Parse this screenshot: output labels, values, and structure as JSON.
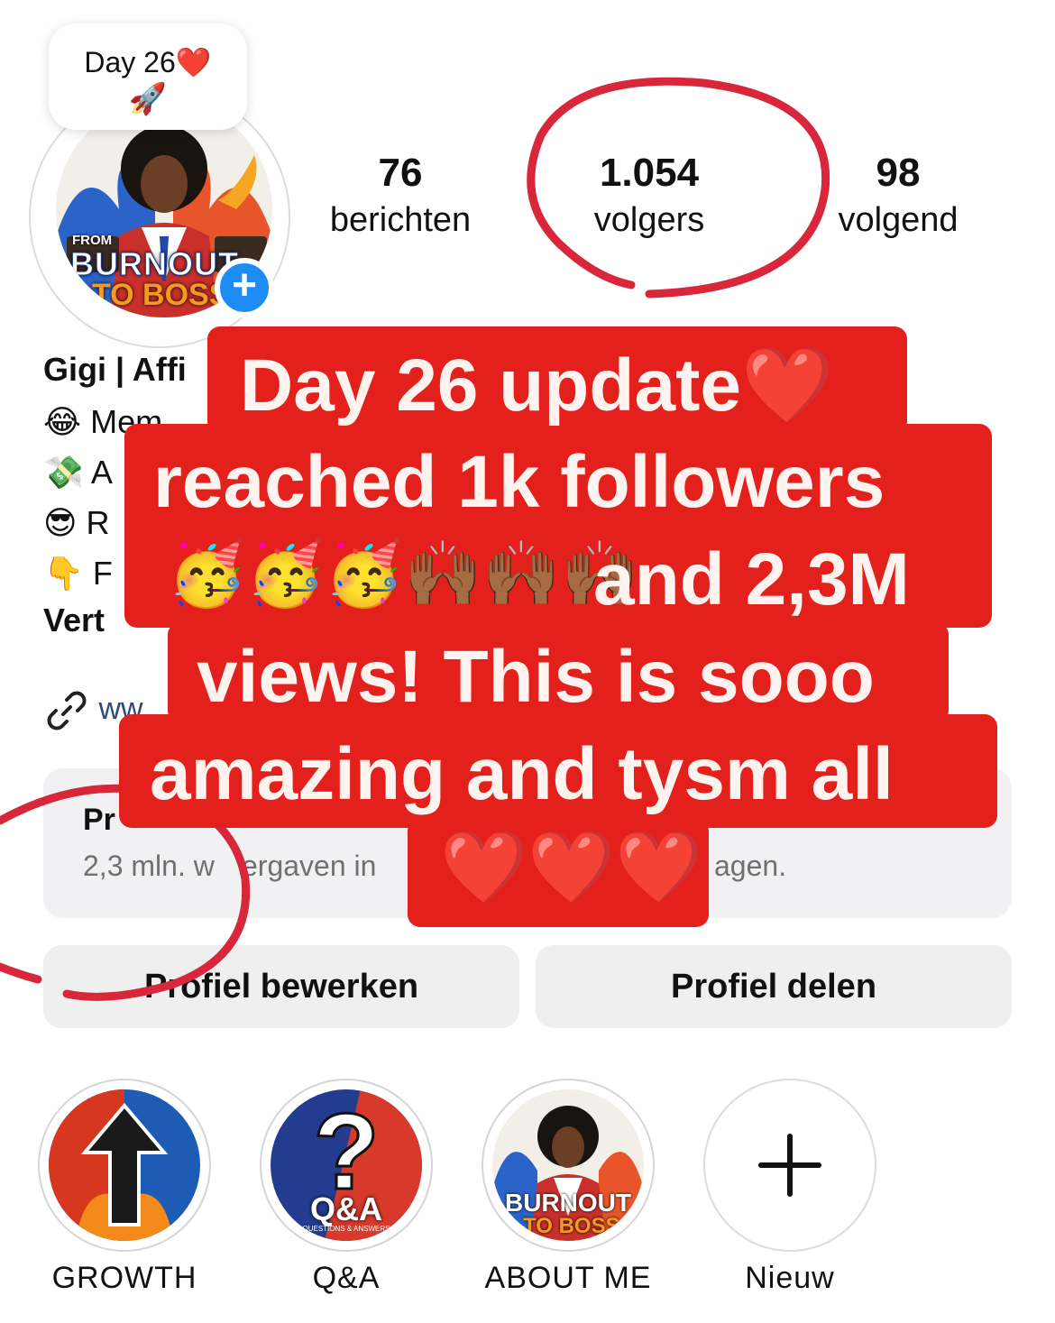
{
  "note": {
    "text": "Day 26",
    "heart": "❤️",
    "rocket": "🚀"
  },
  "avatar": {
    "brand_small": "FROM",
    "brand_line1": "BURNOUT",
    "brand_line2": "TO BOSS"
  },
  "stats": [
    {
      "value": "76",
      "label": "berichten"
    },
    {
      "value": "1.054",
      "label": "volgers"
    },
    {
      "value": "98",
      "label": "volgend"
    }
  ],
  "bio": {
    "name": "Gigi | Affi",
    "lines": [
      {
        "emoji": "😂",
        "text": "Mem"
      },
      {
        "emoji": "💸",
        "text": "A"
      },
      {
        "emoji": "😎",
        "text": "R"
      },
      {
        "emoji": "👇",
        "text": "F"
      }
    ],
    "category": "Vert",
    "link_text": "ww"
  },
  "dashboard": {
    "title": "Pr",
    "subtitle_left": "2,3 mln. w",
    "subtitle_mid": "ergaven in",
    "subtitle_right": "agen."
  },
  "buttons": {
    "edit": "Profiel bewerken",
    "share": "Profiel delen"
  },
  "highlights": [
    {
      "label": "GROWTH"
    },
    {
      "label": "Q&A",
      "badge": "Q&A",
      "badge_sub": "QUESTIONS & ANSWERS"
    },
    {
      "label": "ABOUT ME"
    },
    {
      "label": "Nieuw"
    }
  ],
  "overlay": {
    "line1": "Day 26 update❤️",
    "line2": "reached 1k followers",
    "line3_emojis": "🥳🥳🥳🙌🏾🙌🏾🙌🏾",
    "line3_text": "and 2,3M",
    "line4": "views! This is sooo",
    "line5": "amazing and tysm all",
    "line6": "❤️❤️❤️"
  },
  "colors": {
    "overlay_red": "#e3201b",
    "badge_blue": "#1d8cf5",
    "circle_annotation": "#d8263a"
  }
}
